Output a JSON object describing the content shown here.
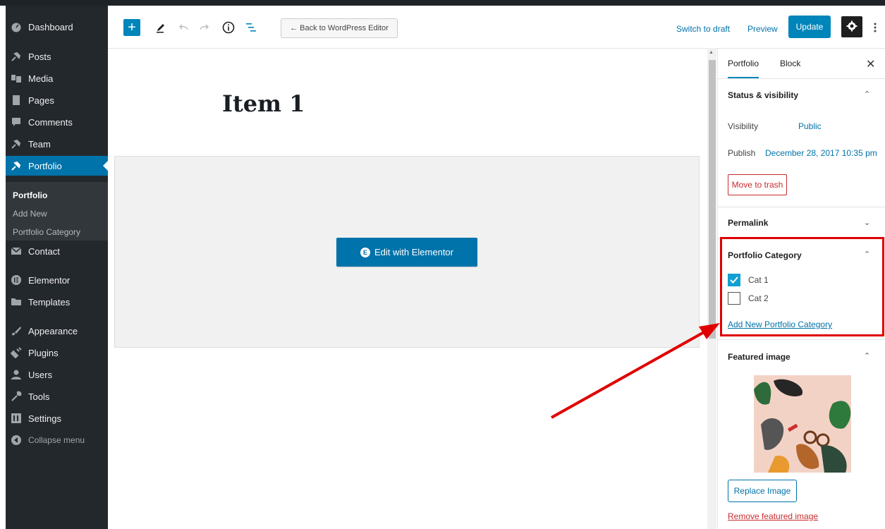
{
  "admin_menu": {
    "items": [
      {
        "label": "Dashboard",
        "icon": "dashboard-icon"
      },
      {
        "label": "Posts",
        "icon": "pin-icon"
      },
      {
        "label": "Media",
        "icon": "media-icon"
      },
      {
        "label": "Pages",
        "icon": "page-icon"
      },
      {
        "label": "Comments",
        "icon": "comment-icon"
      },
      {
        "label": "Team",
        "icon": "pin-icon"
      },
      {
        "label": "Portfolio",
        "icon": "pin-icon"
      },
      {
        "label": "Contact",
        "icon": "mail-icon"
      },
      {
        "label": "Elementor",
        "icon": "elementor-icon"
      },
      {
        "label": "Templates",
        "icon": "folder-icon"
      },
      {
        "label": "Appearance",
        "icon": "brush-icon"
      },
      {
        "label": "Plugins",
        "icon": "plug-icon"
      },
      {
        "label": "Users",
        "icon": "users-icon"
      },
      {
        "label": "Tools",
        "icon": "wrench-icon"
      },
      {
        "label": "Settings",
        "icon": "settings-icon"
      }
    ],
    "submenu": [
      "Portfolio",
      "Add New",
      "Portfolio Category"
    ],
    "collapse_label": "Collapse menu"
  },
  "header": {
    "back_label": "← Back to WordPress Editor",
    "switch_to_draft": "Switch to draft",
    "preview": "Preview",
    "update": "Update"
  },
  "editor": {
    "title": "Item 1",
    "elementor_button": "Edit with Elementor"
  },
  "settings": {
    "tabs": [
      "Portfolio",
      "Block"
    ],
    "status_panel": {
      "title": "Status & visibility",
      "visibility_label": "Visibility",
      "visibility_value": "Public",
      "publish_label": "Publish",
      "publish_value": "December 28, 2017 10:35 pm",
      "trash_label": "Move to trash"
    },
    "permalink_title": "Permalink",
    "category_panel": {
      "title": "Portfolio Category",
      "categories": [
        {
          "label": "Cat 1",
          "checked": true
        },
        {
          "label": "Cat 2",
          "checked": false
        }
      ],
      "add_new_label": "Add New Portfolio Category"
    },
    "featured_panel": {
      "title": "Featured image",
      "replace_label": "Replace Image",
      "remove_label": "Remove featured image"
    }
  },
  "colors": {
    "accent": "#0085ba",
    "admin_bg": "#23282d",
    "annotation_red": "#e00000"
  }
}
